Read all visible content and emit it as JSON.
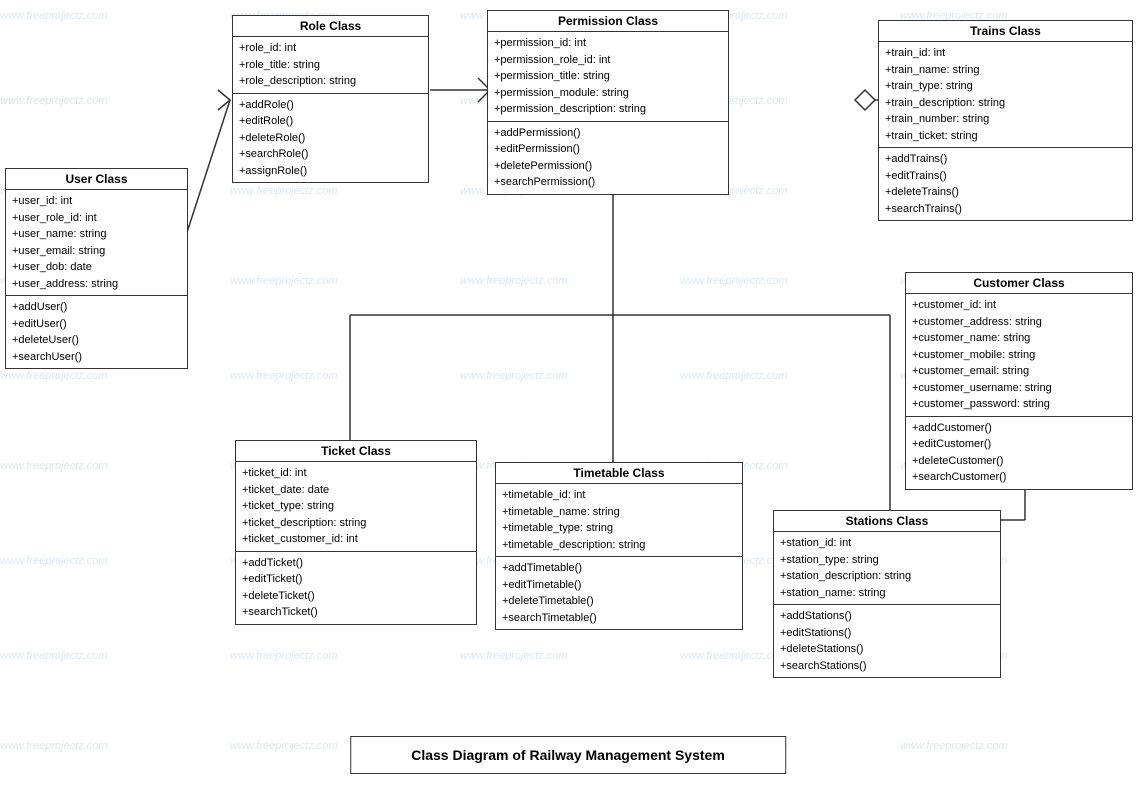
{
  "diagram": {
    "title": "Class Diagram of Railway Management System",
    "watermark_text": "www.freeprojectz.com"
  },
  "classes": {
    "user": {
      "title": "User Class",
      "attributes": [
        "+user_id: int",
        "+user_role_id: int",
        "+user_name: string",
        "+user_email: string",
        "+user_dob: date",
        "+user_address: string"
      ],
      "methods": [
        "+addUser()",
        "+editUser()",
        "+deleteUser()",
        "+searchUser()"
      ]
    },
    "role": {
      "title": "Role Class",
      "attributes": [
        "+role_id: int",
        "+role_title: string",
        "+role_description: string"
      ],
      "methods": [
        "+addRole()",
        "+editRole()",
        "+deleteRole()",
        "+searchRole()",
        "+assignRole()"
      ]
    },
    "permission": {
      "title": "Permission Class",
      "attributes": [
        "+permission_id: int",
        "+permission_role_id: int",
        "+permission_title: string",
        "+permission_module: string",
        "+permission_description: string"
      ],
      "methods": [
        "+addPermission()",
        "+editPermission()",
        "+deletePermission()",
        "+searchPermission()"
      ]
    },
    "trains": {
      "title": "Trains Class",
      "attributes": [
        "+train_id: int",
        "+train_name: string",
        "+train_type: string",
        "+train_description: string",
        "+train_number: string",
        "+train_ticket: string"
      ],
      "methods": [
        "+addTrains()",
        "+editTrains()",
        "+deleteTrains()",
        "+searchTrains()"
      ]
    },
    "customer": {
      "title": "Customer Class",
      "attributes": [
        "+customer_id: int",
        "+customer_address: string",
        "+customer_name: string",
        "+customer_mobile: string",
        "+customer_email: string",
        "+customer_username: string",
        "+customer_password: string"
      ],
      "methods": [
        "+addCustomer()",
        "+editCustomer()",
        "+deleteCustomer()",
        "+searchCustomer()"
      ]
    },
    "ticket": {
      "title": "Ticket Class",
      "attributes": [
        "+ticket_id: int",
        "+ticket_date: date",
        "+ticket_type: string",
        "+ticket_description: string",
        "+ticket_customer_id: int"
      ],
      "methods": [
        "+addTicket()",
        "+editTicket()",
        "+deleteTicket()",
        "+searchTicket()"
      ]
    },
    "timetable": {
      "title": "Timetable Class",
      "attributes": [
        "+timetable_id: int",
        "+timetable_name: string",
        "+timetable_type: string",
        "+timetable_description: string"
      ],
      "methods": [
        "+addTimetable()",
        "+editTimetable()",
        "+deleteTimetable()",
        "+searchTimetable()"
      ]
    },
    "stations": {
      "title": "Stations Class",
      "attributes": [
        "+station_id: int",
        "+station_type: string",
        "+station_description: string",
        "+station_name: string"
      ],
      "methods": [
        "+addStations()",
        "+editStations()",
        "+deleteStations()",
        "+searchStations()"
      ]
    }
  }
}
